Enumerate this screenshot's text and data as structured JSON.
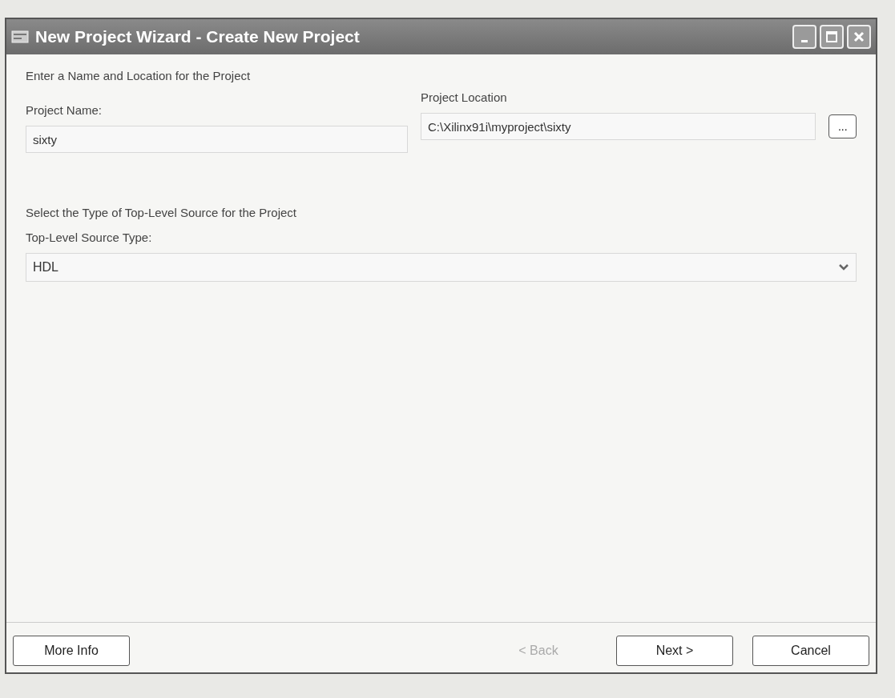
{
  "window": {
    "title": "New Project Wizard - Create New Project"
  },
  "name_section": {
    "heading": "Enter a Name and Location for the Project",
    "project_name": {
      "label": "Project Name:",
      "value": "sixty"
    },
    "project_location": {
      "label": "Project Location",
      "value": "C:\\Xilinx91i\\myproject\\sixty",
      "browse_button": "..."
    }
  },
  "source_section": {
    "heading": "Select the Type of Top-Level Source for the Project",
    "source_type": {
      "label": "Top-Level Source Type:",
      "value": "HDL"
    }
  },
  "buttons": [
    {
      "label": "More Info",
      "disabled": false
    },
    {
      "label": "< Back",
      "disabled": true
    },
    {
      "label": "Next >",
      "disabled": false
    },
    {
      "label": "Cancel",
      "disabled": false
    }
  ]
}
